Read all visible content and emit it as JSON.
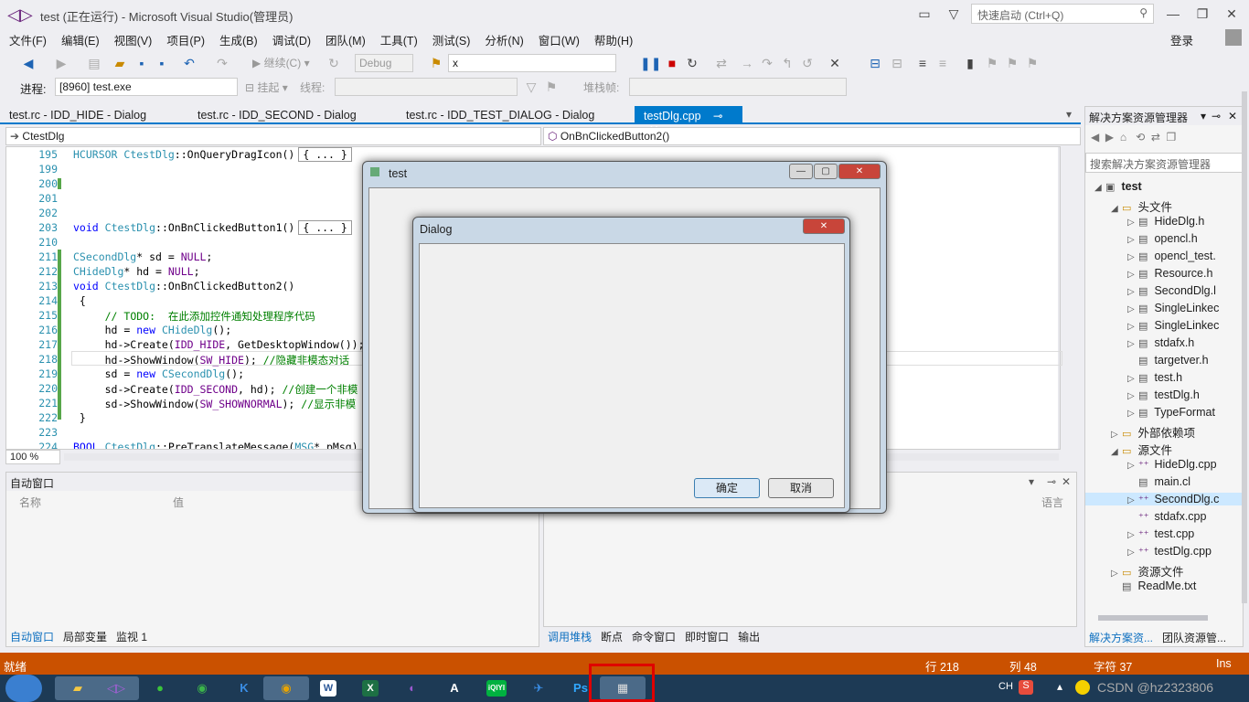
{
  "window": {
    "title": "test (正在运行) - Microsoft Visual Studio(管理员)"
  },
  "quick_launch": {
    "placeholder": "快速启动 (Ctrl+Q)"
  },
  "login": "登录",
  "menu": [
    "文件(F)",
    "编辑(E)",
    "视图(V)",
    "项目(P)",
    "生成(B)",
    "调试(D)",
    "团队(M)",
    "工具(T)",
    "测试(S)",
    "分析(N)",
    "窗口(W)",
    "帮助(H)"
  ],
  "toolbar": {
    "continue_label": "继续(C)",
    "config": "Debug",
    "target": "x"
  },
  "debug_toolbar": {
    "process_label": "进程:",
    "process_value": "[8960] test.exe",
    "suspend_label": "挂起",
    "thread_label": "线程:",
    "stackframe_label": "堆栈帧:"
  },
  "tabs": [
    {
      "label": "test.rc - IDD_HIDE - Dialog"
    },
    {
      "label": "test.rc - IDD_SECOND - Dialog"
    },
    {
      "label": "test.rc - IDD_TEST_DIALOG - Dialog"
    },
    {
      "label": "testDlg.cpp"
    }
  ],
  "nav": {
    "class": "CtestDlg",
    "member": "OnBnClickedButton2()"
  },
  "code": [
    {
      "ln": "195",
      "html": "<span class='ty'>HCURSOR</span> <span class='ty'>CtestDlg</span>::OnQueryDragIcon()<span style='border:1px solid #999;padding:0 4px;margin-left:4px'>{ ... }</span>"
    },
    {
      "ln": "199",
      "html": ""
    },
    {
      "ln": "200",
      "html": ""
    },
    {
      "ln": "201",
      "html": ""
    },
    {
      "ln": "202",
      "html": ""
    },
    {
      "ln": "203",
      "html": "<span class='kw'>void</span> <span class='ty'>CtestDlg</span>::OnBnClickedButton1()<span style='border:1px solid #999;padding:0 4px;margin-left:4px'>{ ... }</span>"
    },
    {
      "ln": "210",
      "html": ""
    },
    {
      "ln": "211",
      "html": "<span class='ty'>CSecondDlg</span>* sd = <span class='mc'>NULL</span>;"
    },
    {
      "ln": "212",
      "html": "<span class='ty'>CHideDlg</span>* hd = <span class='mc'>NULL</span>;"
    },
    {
      "ln": "213",
      "html": "<span class='kw'>void</span> <span class='ty'>CtestDlg</span>::OnBnClickedButton2()"
    },
    {
      "ln": "214",
      "html": " {"
    },
    {
      "ln": "215",
      "html": "     <span class='cm'>// TODO:  在此添加控件通知处理程序代码</span>"
    },
    {
      "ln": "216",
      "html": "     hd = <span class='kw'>new</span> <span class='ty'>CHideDlg</span>();"
    },
    {
      "ln": "217",
      "html": "     hd-&gt;Create(<span class='mc'>IDD_HIDE</span>, GetDesktopWindow());"
    },
    {
      "ln": "218",
      "html": "     hd-&gt;ShowWindow(<span class='mc'>SW_HIDE</span>); <span class='cm'>//隐藏非模态对话</span>"
    },
    {
      "ln": "219",
      "html": "     sd = <span class='kw'>new</span> <span class='ty'>CSecondDlg</span>();"
    },
    {
      "ln": "220",
      "html": "     sd-&gt;Create(<span class='mc'>IDD_SECOND</span>, hd); <span class='cm'>//创建一个非模</span>"
    },
    {
      "ln": "221",
      "html": "     sd-&gt;ShowWindow(<span class='mc'>SW_SHOWNORMAL</span>); <span class='cm'>//显示非模</span>"
    },
    {
      "ln": "222",
      "html": " }"
    },
    {
      "ln": "223",
      "html": ""
    },
    {
      "ln": "224",
      "html": "<span class='kw'>BOOL</span> <span class='ty'>CtestDlg</span>::PreTranslateMessage(<span class='ty'>MSG</span>* pMsg)"
    }
  ],
  "zoom": "100 %",
  "autos": {
    "title": "自动窗口",
    "col_name": "名称",
    "col_value": "值"
  },
  "bottom_left_tabs": [
    "自动窗口",
    "局部变量",
    "监视 1"
  ],
  "bottom_right_tabs": [
    "调用堆栈",
    "断点",
    "命令窗口",
    "即时窗口",
    "输出"
  ],
  "callstack": {
    "col_lang": "语言"
  },
  "solution": {
    "title": "解决方案资源管理器",
    "search_placeholder": "搜索解决方案资源管理器",
    "tree": [
      {
        "label": "test",
        "indent": 0,
        "arrow": "◢",
        "icon": "▣",
        "bold": true
      },
      {
        "label": "头文件",
        "indent": 1,
        "arrow": "◢",
        "icon": "▭"
      },
      {
        "label": "HideDlg.h",
        "indent": 2,
        "arrow": "▷",
        "icon": "▤"
      },
      {
        "label": "opencl.h",
        "indent": 2,
        "arrow": "▷",
        "icon": "▤"
      },
      {
        "label": "opencl_test.",
        "indent": 2,
        "arrow": "▷",
        "icon": "▤"
      },
      {
        "label": "Resource.h",
        "indent": 2,
        "arrow": "▷",
        "icon": "▤"
      },
      {
        "label": "SecondDlg.l",
        "indent": 2,
        "arrow": "▷",
        "icon": "▤"
      },
      {
        "label": "SingleLinkec",
        "indent": 2,
        "arrow": "▷",
        "icon": "▤"
      },
      {
        "label": "SingleLinkec",
        "indent": 2,
        "arrow": "▷",
        "icon": "▤"
      },
      {
        "label": "stdafx.h",
        "indent": 2,
        "arrow": "▷",
        "icon": "▤"
      },
      {
        "label": "targetver.h",
        "indent": 2,
        "arrow": "",
        "icon": "▤"
      },
      {
        "label": "test.h",
        "indent": 2,
        "arrow": "▷",
        "icon": "▤"
      },
      {
        "label": "testDlg.h",
        "indent": 2,
        "arrow": "▷",
        "icon": "▤"
      },
      {
        "label": "TypeFormat",
        "indent": 2,
        "arrow": "▷",
        "icon": "▤"
      },
      {
        "label": "外部依赖项",
        "indent": 1,
        "arrow": "▷",
        "icon": "▭"
      },
      {
        "label": "源文件",
        "indent": 1,
        "arrow": "◢",
        "icon": "▭"
      },
      {
        "label": "HideDlg.cpp",
        "indent": 2,
        "arrow": "▷",
        "icon": "⁺⁺"
      },
      {
        "label": "main.cl",
        "indent": 2,
        "arrow": "",
        "icon": "▤"
      },
      {
        "label": "SecondDlg.c",
        "indent": 2,
        "arrow": "▷",
        "icon": "⁺⁺",
        "selected": true
      },
      {
        "label": "stdafx.cpp",
        "indent": 2,
        "arrow": "",
        "icon": "⁺⁺"
      },
      {
        "label": "test.cpp",
        "indent": 2,
        "arrow": "▷",
        "icon": "⁺⁺"
      },
      {
        "label": "testDlg.cpp",
        "indent": 2,
        "arrow": "▷",
        "icon": "⁺⁺"
      },
      {
        "label": "资源文件",
        "indent": 1,
        "arrow": "▷",
        "icon": "▭"
      },
      {
        "label": "ReadMe.txt",
        "indent": 1,
        "arrow": "",
        "icon": "▤"
      }
    ],
    "bottom_tabs": [
      "解决方案资...",
      "团队资源管..."
    ]
  },
  "status": {
    "ready": "就绪",
    "line": "行 218",
    "col": "列 48",
    "char": "字符 37",
    "mode": "Ins"
  },
  "dialog_test": {
    "title": "test"
  },
  "dialog_main": {
    "title": "Dialog",
    "ok": "确定",
    "cancel": "取消"
  },
  "taskbar": {
    "items": [
      "folder",
      "visual-studio",
      "wechat",
      "360-browser",
      "k-app",
      "chrome",
      "word",
      "excel",
      "vpn",
      "font-app",
      "iqiyi",
      "feishu",
      "photoshop",
      "test-app"
    ],
    "tray_text": "CH",
    "watermark": "CSDN @hz2323806"
  },
  "colors": {
    "accent": "#007acc",
    "status": "#ca5100",
    "taskbar": "#1d3a55",
    "highlight": "#e00000"
  }
}
